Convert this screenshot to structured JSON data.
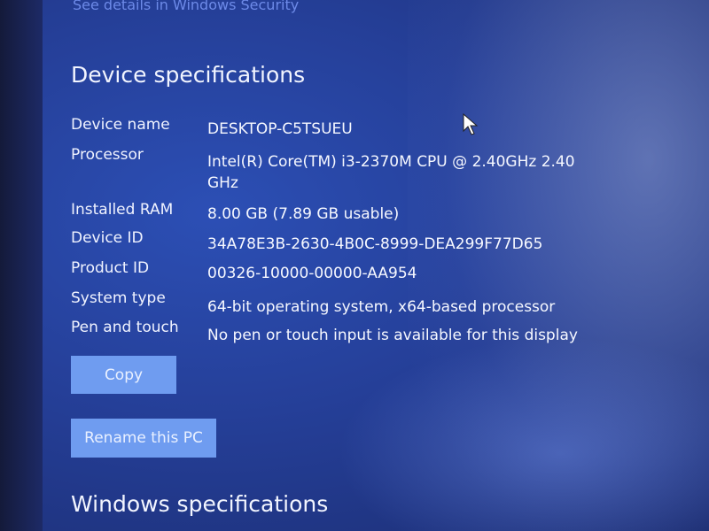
{
  "top_link": "See details in Windows Security",
  "device_specs": {
    "title": "Device specifications",
    "rows": [
      {
        "label": "Device name",
        "value": "DESKTOP-C5TSUEU"
      },
      {
        "label": "Processor",
        "value": "Intel(R) Core(TM) i3-2370M CPU @ 2.40GHz   2.40 GHz"
      },
      {
        "label": "Installed RAM",
        "value": "8.00 GB (7.89 GB usable)"
      },
      {
        "label": "Device ID",
        "value": "34A78E3B-2630-4B0C-8999-DEA299F77D65"
      },
      {
        "label": "Product ID",
        "value": "00326-10000-00000-AA954"
      },
      {
        "label": "System type",
        "value": "64-bit operating system, x64-based processor"
      },
      {
        "label": "Pen and touch",
        "value": "No pen or touch input is available for this display"
      }
    ]
  },
  "buttons": {
    "copy": "Copy",
    "rename": "Rename this PC"
  },
  "windows_specs": {
    "title": "Windows specifications"
  },
  "cursor": "mouse-pointer"
}
